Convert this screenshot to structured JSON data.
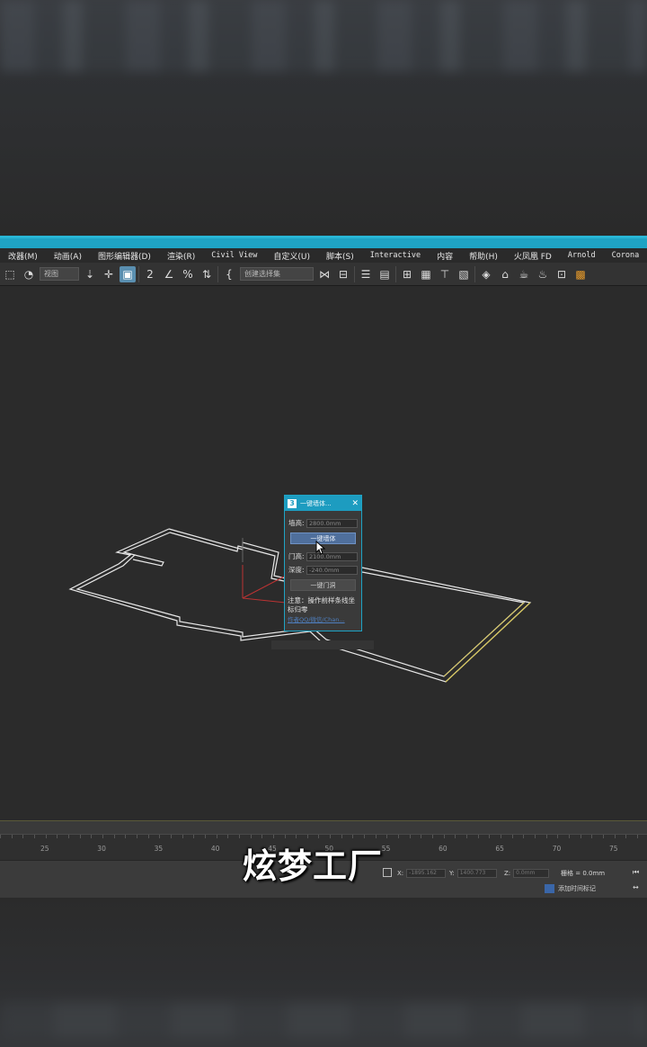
{
  "menubar": {
    "items": [
      "改器(M)",
      "动画(A)",
      "图形编辑器(D)",
      "渲染(R)",
      "Civil View",
      "自定义(U)",
      "脚本(S)",
      "Interactive",
      "内容",
      "帮助(H)",
      "火凤凰 FD",
      "Arnold",
      "Corona"
    ]
  },
  "toolbar": {
    "view_dropdown": "视图",
    "selection_set_dropdown": "创建选择集"
  },
  "dialog": {
    "title": "一键墙体...",
    "logo": "3",
    "close": "✕",
    "wall_height_label": "墙高:",
    "wall_height_value": "2800.0mm",
    "make_wall_button": "一键墙体",
    "door_height_label": "门高:",
    "door_height_value": "2100.0mm",
    "depth_label": "深度:",
    "depth_value": "-240.0mm",
    "make_door_button": "一键门洞",
    "note": "注意：操作前样条线坐标归零",
    "link": "作者QQ/微信/Chan..."
  },
  "timeline": {
    "ticks": [
      "25",
      "30",
      "35",
      "40",
      "45",
      "50",
      "55",
      "60",
      "65",
      "70",
      "75"
    ]
  },
  "status": {
    "x_label": "X:",
    "x_value": "-1895.162",
    "y_label": "Y:",
    "y_value": "1400.773",
    "z_label": "Z:",
    "z_value": "0.0mm",
    "grid": "栅格 = 0.0mm",
    "add_time_tag": "添加时间标记"
  },
  "watermark": "炫梦工厂",
  "colors": {
    "accent": "#1fa3c4",
    "viewport_bg": "#2b2b2b",
    "wireframe": "#e8e8e8",
    "highlight_edge": "#d8c75a"
  }
}
